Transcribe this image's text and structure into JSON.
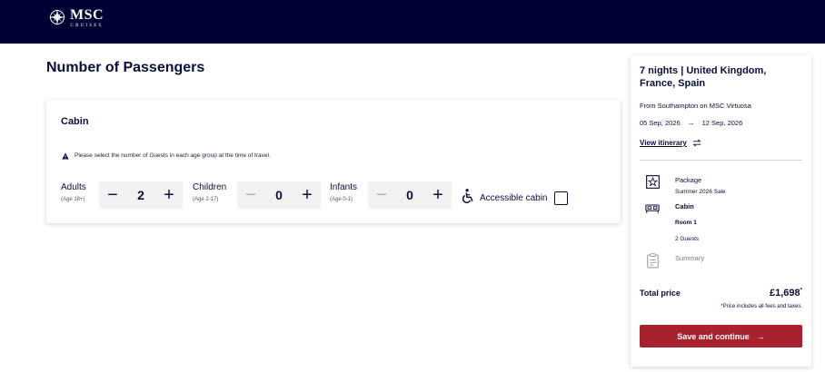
{
  "brand": {
    "name": "MSC",
    "sub": "CRUISES"
  },
  "page": {
    "title": "Number of Passengers"
  },
  "cabin": {
    "title": "Cabin",
    "notice": "Please select the number of Guests in each age group at the time of travel.",
    "passengers": [
      {
        "label": "Adults",
        "age": "(Age 18+)",
        "value": "2",
        "minus": "−",
        "plus": "+"
      },
      {
        "label": "Children",
        "age": "(Age 2-17)",
        "value": "0",
        "minus": "−",
        "plus": "+"
      },
      {
        "label": "Infants",
        "age": "(Age 0-1)",
        "value": "0",
        "minus": "−",
        "plus": "+"
      }
    ],
    "accessible_label": "Accessible cabin"
  },
  "summary": {
    "title": "7 nights | United Kingdom, France, Spain",
    "from": "From Southampton on MSC Virtuosa",
    "date_start": "05 Sep, 2026",
    "date_arrow": "→",
    "date_end": "12 Sep, 2026",
    "itinerary_link": "View itinerary",
    "package_label": "Package",
    "package_value": "Summer 2026 Sale",
    "cabin_label": "Cabin",
    "room": "Room 1",
    "guests": "2 Guests",
    "summary_label": "Summary",
    "total_label": "Total price",
    "total_price": "£1,698",
    "total_mark": "*",
    "price_note": "*Price includes all fees and taxes.",
    "save_button": "Save and continue",
    "save_arrow": "→"
  },
  "colors": {
    "header_bg": "#000033",
    "primary_text": "#0a0e3a",
    "button_red": "#a7212f"
  }
}
